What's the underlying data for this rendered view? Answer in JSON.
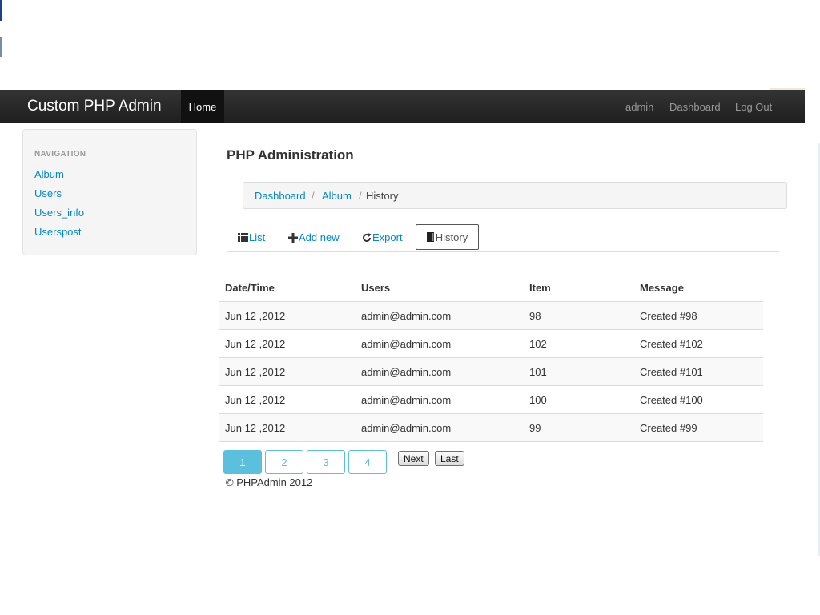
{
  "navbar": {
    "brand": "Custom PHP Admin",
    "home": "Home",
    "user": "admin",
    "dashboard": "Dashboard",
    "logout": "Log Out",
    "background_color": "#222222"
  },
  "sidebar": {
    "header": "NAVIGATION",
    "items": [
      {
        "label": "Album"
      },
      {
        "label": "Users"
      },
      {
        "label": "Users_info"
      },
      {
        "label": "Userspost"
      }
    ]
  },
  "main": {
    "title": "PHP Administration",
    "breadcrumb": {
      "items": [
        "Dashboard",
        "Album",
        "History"
      ],
      "separator": "/"
    },
    "tabs": [
      {
        "label": "List",
        "icon": "list-icon"
      },
      {
        "label": "Add new",
        "icon": "plus-icon"
      },
      {
        "label": "Export",
        "icon": "refresh-icon"
      },
      {
        "label": "History",
        "icon": "book-icon",
        "active": true
      }
    ],
    "table": {
      "columns": [
        "Date/Time",
        "Users",
        "Item",
        "Message"
      ],
      "rows": [
        [
          "Jun 12 ,2012",
          "admin@admin.com",
          "98",
          "Created #98"
        ],
        [
          "Jun 12 ,2012",
          "admin@admin.com",
          "102",
          "Created #102"
        ],
        [
          "Jun 12 ,2012",
          "admin@admin.com",
          "101",
          "Created #101"
        ],
        [
          "Jun 12 ,2012",
          "admin@admin.com",
          "100",
          "Created #100"
        ],
        [
          "Jun 12 ,2012",
          "admin@admin.com",
          "99",
          "Created #99"
        ]
      ]
    },
    "pagination": {
      "pages": [
        "1",
        "2",
        "3",
        "4"
      ],
      "current": "1",
      "next": "Next",
      "last": "Last",
      "accent_color": "#5bc0de"
    },
    "footer": "© PHPAdmin 2012"
  },
  "colors": {
    "link": "#0088cc"
  }
}
